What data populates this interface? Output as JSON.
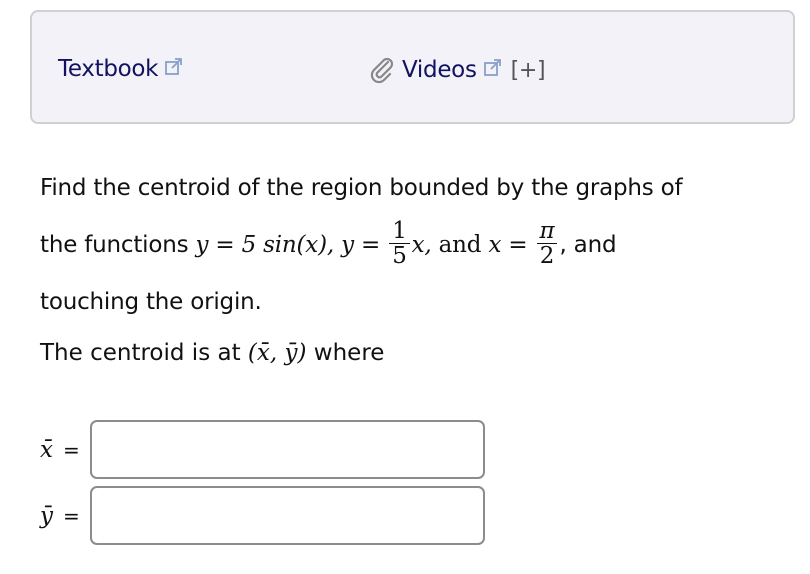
{
  "resources": {
    "textbook_label": "Textbook",
    "videos_label": "Videos",
    "expand_label": "[+]",
    "icons": [
      "external-link-icon",
      "paperclip-icon"
    ],
    "link_color": "#12125e"
  },
  "question": {
    "line1": "Find the centroid of the region bounded by the graphs of",
    "line2_prefix": "the functions",
    "f1": "y = 5 sin(x),",
    "f2_lhs": "y =",
    "f2_num": "1",
    "f2_den": "5",
    "f2_var": "x,",
    "and_word": "and",
    "x_var": "x =",
    "pi_num": "π",
    "pi_den": "2",
    "line2_suffix": ", and",
    "line3": "touching the origin."
  },
  "centroid": {
    "text_prefix": "The centroid is at",
    "coords": "(x̄, ȳ)",
    "text_suffix": "where"
  },
  "answers": {
    "x_label": "x̄",
    "y_label": "ȳ",
    "equals": "=",
    "x_value": "",
    "y_value": ""
  }
}
